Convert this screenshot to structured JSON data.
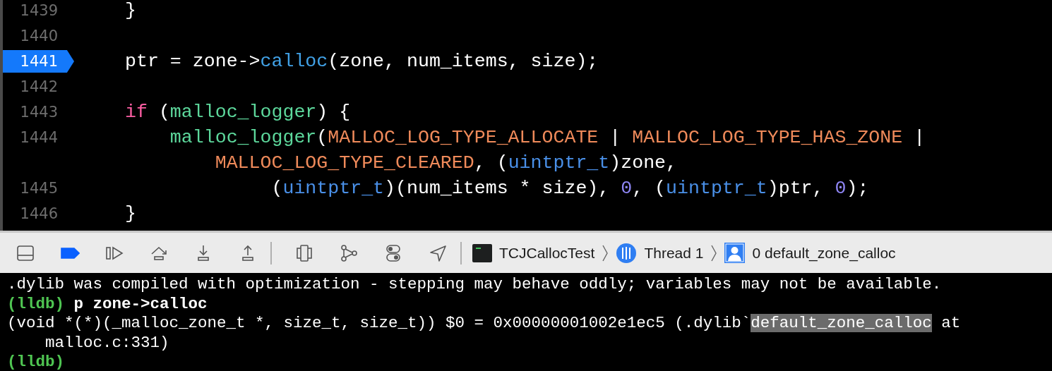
{
  "code_lines": [
    {
      "number": "1439",
      "current": false,
      "tokens": [
        {
          "text": "}",
          "kind": "plain"
        }
      ]
    },
    {
      "number": "1440",
      "current": false
    },
    {
      "number": "1441",
      "current": true,
      "tokens": [
        {
          "text": "ptr = zone->",
          "kind": "plain"
        },
        {
          "text": "calloc",
          "kind": "member"
        },
        {
          "text": "(zone, num_items, size);",
          "kind": "plain"
        }
      ]
    },
    {
      "number": "1442",
      "current": false
    },
    {
      "number": "1443",
      "current": false,
      "tokens": [
        {
          "text": "if",
          "kind": "keyword"
        },
        {
          "text": " (",
          "kind": "plain"
        },
        {
          "text": "malloc_logger",
          "kind": "function"
        },
        {
          "text": ") {",
          "kind": "plain"
        }
      ]
    },
    {
      "number": "1444",
      "current": false,
      "tokens": [
        {
          "text": "    malloc_logger",
          "kind": "function"
        },
        {
          "text": "(",
          "kind": "plain"
        },
        {
          "text": "MALLOC_LOG_TYPE_ALLOCATE",
          "kind": "macro"
        },
        {
          "text": " | ",
          "kind": "plain"
        },
        {
          "text": "MALLOC_LOG_TYPE_HAS_ZONE",
          "kind": "macro"
        },
        {
          "text": " |",
          "kind": "plain"
        }
      ]
    },
    {
      "tokens": [
        {
          "text": "        MALLOC_LOG_TYPE_CLEARED",
          "kind": "macro"
        },
        {
          "text": ", (",
          "kind": "plain"
        },
        {
          "text": "uintptr_t",
          "kind": "type"
        },
        {
          "text": ")zone,",
          "kind": "plain"
        }
      ]
    },
    {
      "number": "1445",
      "current": false,
      "tokens": [
        {
          "text": "             (",
          "kind": "plain"
        },
        {
          "text": "uintptr_t",
          "kind": "type"
        },
        {
          "text": ")(num_items * size), ",
          "kind": "plain"
        },
        {
          "text": "0",
          "kind": "number"
        },
        {
          "text": ", (",
          "kind": "plain"
        },
        {
          "text": "uintptr_t",
          "kind": "type"
        },
        {
          "text": ")ptr, ",
          "kind": "plain"
        },
        {
          "text": "0",
          "kind": "number"
        },
        {
          "text": ");",
          "kind": "plain"
        }
      ]
    },
    {
      "number": "1446",
      "current": false,
      "tokens": [
        {
          "text": "}",
          "kind": "plain"
        }
      ]
    }
  ],
  "debug_bar": {
    "buttons": [
      {
        "kind": "hide-panel",
        "on": false
      },
      {
        "kind": "breakpoints",
        "on": true
      },
      {
        "kind": "continue",
        "on": false
      },
      {
        "kind": "step-over",
        "on": false
      },
      {
        "kind": "step-into",
        "on": false
      },
      {
        "kind": "step-out",
        "on": false
      },
      {
        "kind": "separator"
      },
      {
        "kind": "view-hierarchy",
        "on": false
      },
      {
        "kind": "memory-graph",
        "on": false
      },
      {
        "kind": "environment",
        "on": false
      },
      {
        "kind": "location",
        "on": false
      },
      {
        "kind": "separator"
      }
    ],
    "breadcrumb": [
      {
        "kind": "app",
        "label": "TCJCallocTest"
      },
      {
        "kind": "thread",
        "label": "Thread 1"
      },
      {
        "kind": "frame",
        "label": "0 default_zone_calloc"
      }
    ]
  },
  "console_lines": [
    {
      "segments": [
        {
          "text": ".dylib was compiled with optimization - stepping may behave oddly; variables may not be available.",
          "kind": "output"
        }
      ]
    },
    {
      "segments": [
        {
          "text": "(lldb)",
          "kind": "prompt"
        },
        {
          "text": " p zone->calloc",
          "kind": "command"
        }
      ]
    },
    {
      "segments": [
        {
          "text": "(void *(*)(_malloc_zone_t *, size_t, size_t)) $0 = 0x00000001002e1ec5 (.dylib`",
          "kind": "output"
        },
        {
          "text": "default_zone_calloc",
          "kind": "highlight"
        },
        {
          "text": " at",
          "kind": "output"
        }
      ]
    },
    {
      "segments": [
        {
          "text": "    malloc.c:331)",
          "kind": "output"
        }
      ]
    },
    {
      "segments": [
        {
          "text": "(lldb)",
          "kind": "prompt"
        }
      ]
    }
  ]
}
